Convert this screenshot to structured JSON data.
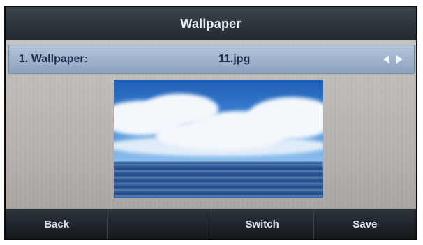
{
  "title": "Wallpaper",
  "setting_row": {
    "label": "1. Wallpaper:",
    "value": "11.jpg",
    "icons": [
      "arrow-left-icon",
      "arrow-right-icon"
    ]
  },
  "softkeys": [
    {
      "label": "Back"
    },
    {
      "label": ""
    },
    {
      "label": "Switch"
    },
    {
      "label": "Save"
    }
  ],
  "colors": {
    "titlebar": "#2f373d",
    "highlight_row": "#9fb3cc",
    "background": "#bdb8b5",
    "softkey_bar": "#1e2428"
  }
}
